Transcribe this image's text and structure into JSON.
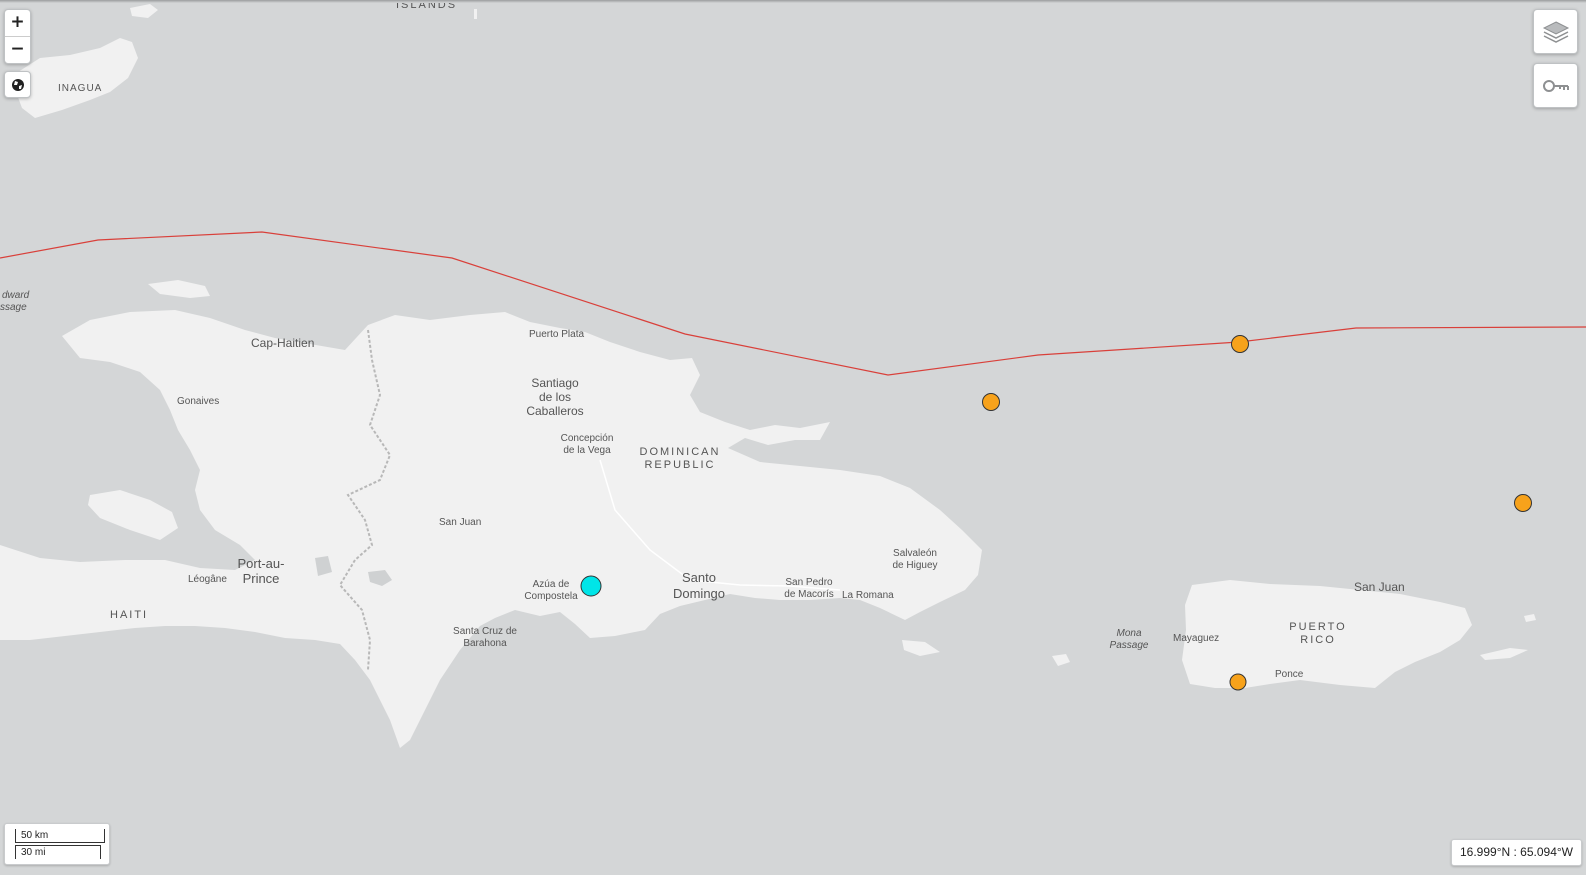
{
  "map": {
    "labels": {
      "islands": "ISLANDS",
      "inagua": "INAGUA",
      "windward": "dward",
      "passage_w": "ssage",
      "cap_haitien": "Cap-Haitien",
      "gonaives": "Gonaives",
      "puerto_plata": "Puerto Plata",
      "santiago_1": "Santiago",
      "santiago_2": "de los",
      "santiago_3": "Caballeros",
      "concepcion_1": "Concepción",
      "concepcion_2": "de la Vega",
      "dominican_1": "DOMINICAN",
      "dominican_2": "REPUBLIC",
      "san_juan_dr": "San Juan",
      "port_1": "Port-au-",
      "port_2": "Prince",
      "leogane": "Léogâne",
      "haiti": "HAITI",
      "azua_1": "Azúa de",
      "azua_2": "Compostela",
      "santa_cruz_1": "Santa Cruz de",
      "santa_cruz_2": "Barahona",
      "santo_1": "Santo",
      "santo_2": "Domingo",
      "san_pedro_1": "San Pedro",
      "san_pedro_2": "de Macorís",
      "la_romana": "La Romana",
      "salvaleon_1": "Salvaleón",
      "salvaleon_2": "de Higuey",
      "mona_1": "Mona",
      "mona_2": "Passage",
      "mayaguez": "Mayaguez",
      "puerto_rico_1": "PUERTO",
      "puerto_rico_2": "RICO",
      "san_juan_pr": "San Juan",
      "ponce": "Ponce"
    },
    "markers": [
      {
        "type": "earthquake",
        "color": "#00e5e8"
      },
      {
        "type": "earthquake",
        "color": "#f7a21b"
      },
      {
        "type": "earthquake",
        "color": "#f7a21b"
      },
      {
        "type": "earthquake",
        "color": "#f7a21b"
      },
      {
        "type": "earthquake",
        "color": "#f7a21b"
      }
    ]
  },
  "controls": {
    "zoom_in": "+",
    "zoom_out": "−",
    "globe_icon": "globe-icon",
    "layers_icon": "layers-icon",
    "legend_icon": "key-icon"
  },
  "scale": {
    "km": "50 km",
    "mi": "30 mi"
  },
  "coordinates": "16.999°N : 65.094°W"
}
